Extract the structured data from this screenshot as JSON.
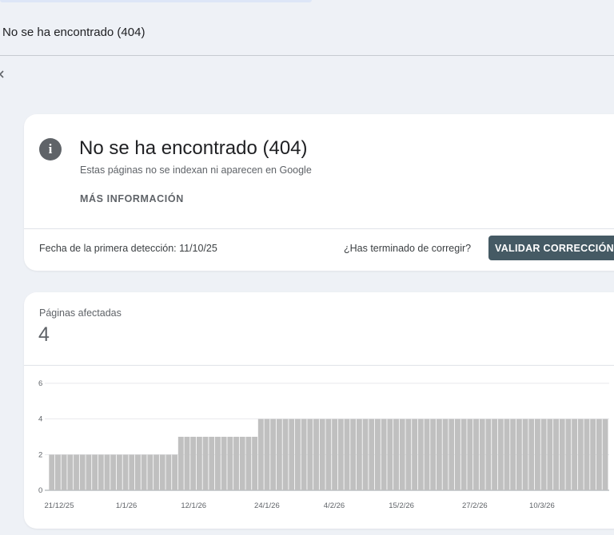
{
  "header": {
    "title": "No se ha encontrado (404)"
  },
  "issue": {
    "icon": "info-icon",
    "icon_glyph": "i",
    "title": "No se ha encontrado (404)",
    "description": "Estas páginas no se indexan ni aparecen en Google",
    "learn_more": "MÁS INFORMACIÓN",
    "first_detected": "Fecha de la primera detección: 11/10/25",
    "fix_question": "¿Has terminado de corregir?",
    "validate_button": "VALIDAR CORRECCIÓN"
  },
  "metrics": {
    "affected_label": "Páginas afectadas",
    "affected_value": "4"
  },
  "colors": {
    "bar": "#c0c0c0",
    "button": "#455a64",
    "page_bg": "#eef1f6"
  },
  "chart_data": {
    "type": "bar",
    "title": "",
    "xlabel": "",
    "ylabel": "",
    "ylim": [
      0,
      6
    ],
    "y_ticks": [
      0,
      2,
      4,
      6
    ],
    "grid": true,
    "x_tick_labels": [
      "21/12/25",
      "1/1/26",
      "12/1/26",
      "24/1/26",
      "4/2/26",
      "15/2/26",
      "27/2/26",
      "10/3/26"
    ],
    "segments": [
      {
        "from": "21/12/25",
        "to": "10/1/26",
        "days": 21,
        "value": 2
      },
      {
        "from": "11/1/26",
        "to": "23/1/26",
        "days": 13,
        "value": 3
      },
      {
        "from": "24/1/26",
        "to": "21/3/26",
        "days": 57,
        "value": 4
      }
    ]
  }
}
